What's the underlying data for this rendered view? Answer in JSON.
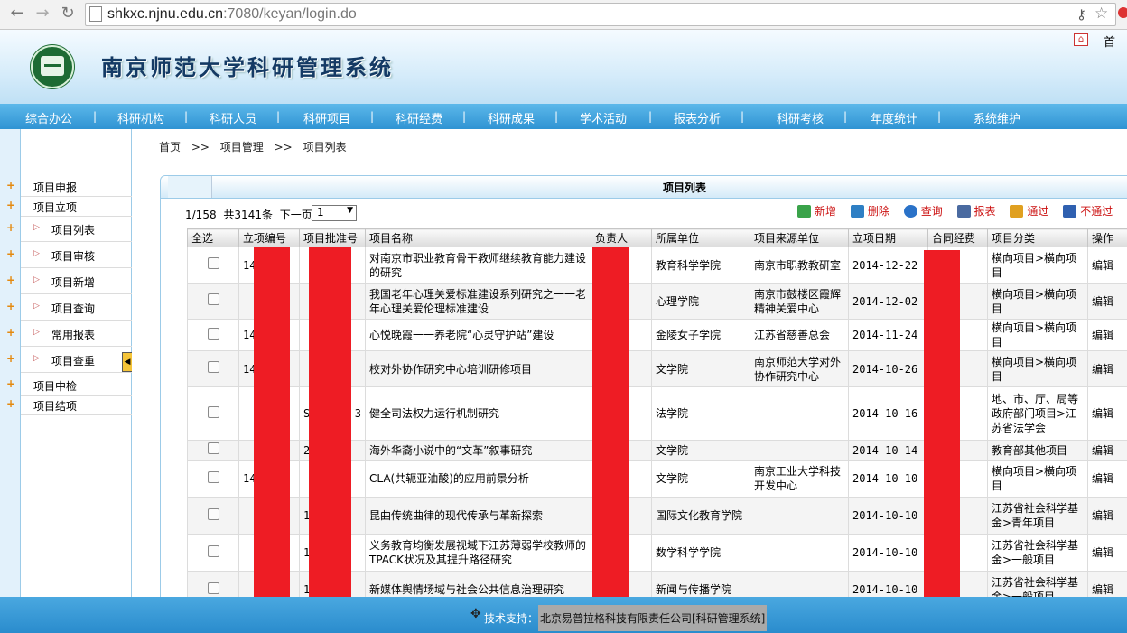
{
  "browser": {
    "url_host": "shkxc.njnu.edu.cn",
    "url_path": ":7080/keyan/login.do",
    "back_icon": "back-arrow-icon",
    "forward_icon": "forward-arrow-icon",
    "reload_icon": "reload-icon"
  },
  "header": {
    "title": "南京师范大学科研管理系统",
    "home_label": "首"
  },
  "menu": [
    "综合办公",
    "科研机构",
    "科研人员",
    "科研项目",
    "科研经费",
    "科研成果",
    "学术活动",
    "报表分析",
    "科研考核",
    "年度统计",
    "系统维护"
  ],
  "sidebar": {
    "items": [
      {
        "label": "项目申报",
        "level": 1
      },
      {
        "label": "项目立项",
        "level": 1
      },
      {
        "label": "项目列表",
        "level": 2
      },
      {
        "label": "项目审核",
        "level": 2
      },
      {
        "label": "项目新增",
        "level": 2
      },
      {
        "label": "项目查询",
        "level": 2
      },
      {
        "label": "常用报表",
        "level": 2
      },
      {
        "label": "项目查重",
        "level": 2
      },
      {
        "label": "项目中检",
        "level": 1
      },
      {
        "label": "项目结项",
        "level": 1
      }
    ]
  },
  "breadcrumb": [
    "首页",
    ">>",
    "项目管理",
    ">>",
    "项目列表"
  ],
  "panel": {
    "title": "项目列表",
    "pager_pos": "1/158",
    "pager_total": "共3141条",
    "pager_next": "下一页",
    "page_select": "1"
  },
  "actions": [
    "新增",
    "删除",
    "查询",
    "报表",
    "通过",
    "不通过"
  ],
  "action_colors": [
    "#3aa34a",
    "#2e7fc4",
    "#2a72c8",
    "#4a6aa0",
    "#e0a020",
    "#2f60b0"
  ],
  "table": {
    "headers": [
      "全选",
      "立项编号",
      "项目批准号",
      "项目名称",
      "负责人",
      "所属单位",
      "项目来源单位",
      "立项日期",
      "合同经费",
      "项目分类",
      "操作"
    ],
    "rows": [
      {
        "code": "141",
        "approval": "",
        "name": "对南京市职业教育骨干教师继续教育能力建设的研究",
        "dept": "教育科学学院",
        "source": "南京市职教教研室",
        "date": "2014-12-22",
        "category": "横向项目>横向项目",
        "op": "编辑"
      },
      {
        "code": "",
        "approval": "",
        "name": "我国老年心理关爱标准建设系列研究之一一老年心理关爱伦理标准建设",
        "dept": "心理学院",
        "source": "南京市鼓楼区霞辉精神关爱中心",
        "date": "2014-12-02",
        "category": "横向项目>横向项目",
        "op": "编辑"
      },
      {
        "code": "141",
        "approval": "",
        "name": "心悦晚霞一一养老院“心灵守护站”建设",
        "dept": "金陵女子学院",
        "source": "江苏省慈善总会",
        "date": "2014-11-24",
        "category": "横向项目>横向项目",
        "op": "编辑"
      },
      {
        "code": "141",
        "approval": "",
        "name": "校对外协作研究中心培训研修项目",
        "dept": "文学院",
        "source": "南京师范大学对外协作研究中心",
        "date": "2014-10-26",
        "category": "横向项目>横向项目",
        "op": "编辑"
      },
      {
        "code": "",
        "approval": "SK",
        "approval_tail": "3",
        "name": "健全司法权力运行机制研究",
        "dept": "法学院",
        "source": "",
        "date": "2014-10-16",
        "category": "地、市、厅、局等政府部门项目>江苏省法学会",
        "op": "编辑"
      },
      {
        "code": "",
        "approval": "20",
        "name": "海外华裔小说中的“文革”叙事研究",
        "dept": "文学院",
        "source": "",
        "date": "2014-10-14",
        "category": "教育部其他项目",
        "op": "编辑"
      },
      {
        "code": "141",
        "approval": "",
        "name": "CLA(共轭亚油酸)的应用前景分析",
        "dept": "文学院",
        "source": "南京工业大学科技开发中心",
        "date": "2014-10-10",
        "category": "横向项目>横向项目",
        "op": "编辑"
      },
      {
        "code": "",
        "approval": "14",
        "name": "昆曲传统曲律的现代传承与革新探索",
        "dept": "国际文化教育学院",
        "source": "",
        "date": "2014-10-10",
        "category": "江苏省社会科学基金>青年项目",
        "op": "编辑"
      },
      {
        "code": "",
        "approval": "14",
        "name": "义务教育均衡发展视域下江苏薄弱学校教师的TPACK状况及其提升路径研究",
        "dept": "数学科学学院",
        "source": "",
        "date": "2014-10-10",
        "category": "江苏省社会科学基金>一般项目",
        "op": "编辑"
      },
      {
        "code": "",
        "approval": "14",
        "name": "新媒体舆情场域与社会公共信息治理研究",
        "dept": "新闻与传播学院",
        "source": "",
        "date": "2014-10-10",
        "category": "江苏省社会科学基金>一般项目",
        "op": "编辑"
      }
    ]
  },
  "footer": {
    "label": "技术支持：",
    "company": "北京易普拉格科技有限责任公司[科研管理系统]"
  }
}
